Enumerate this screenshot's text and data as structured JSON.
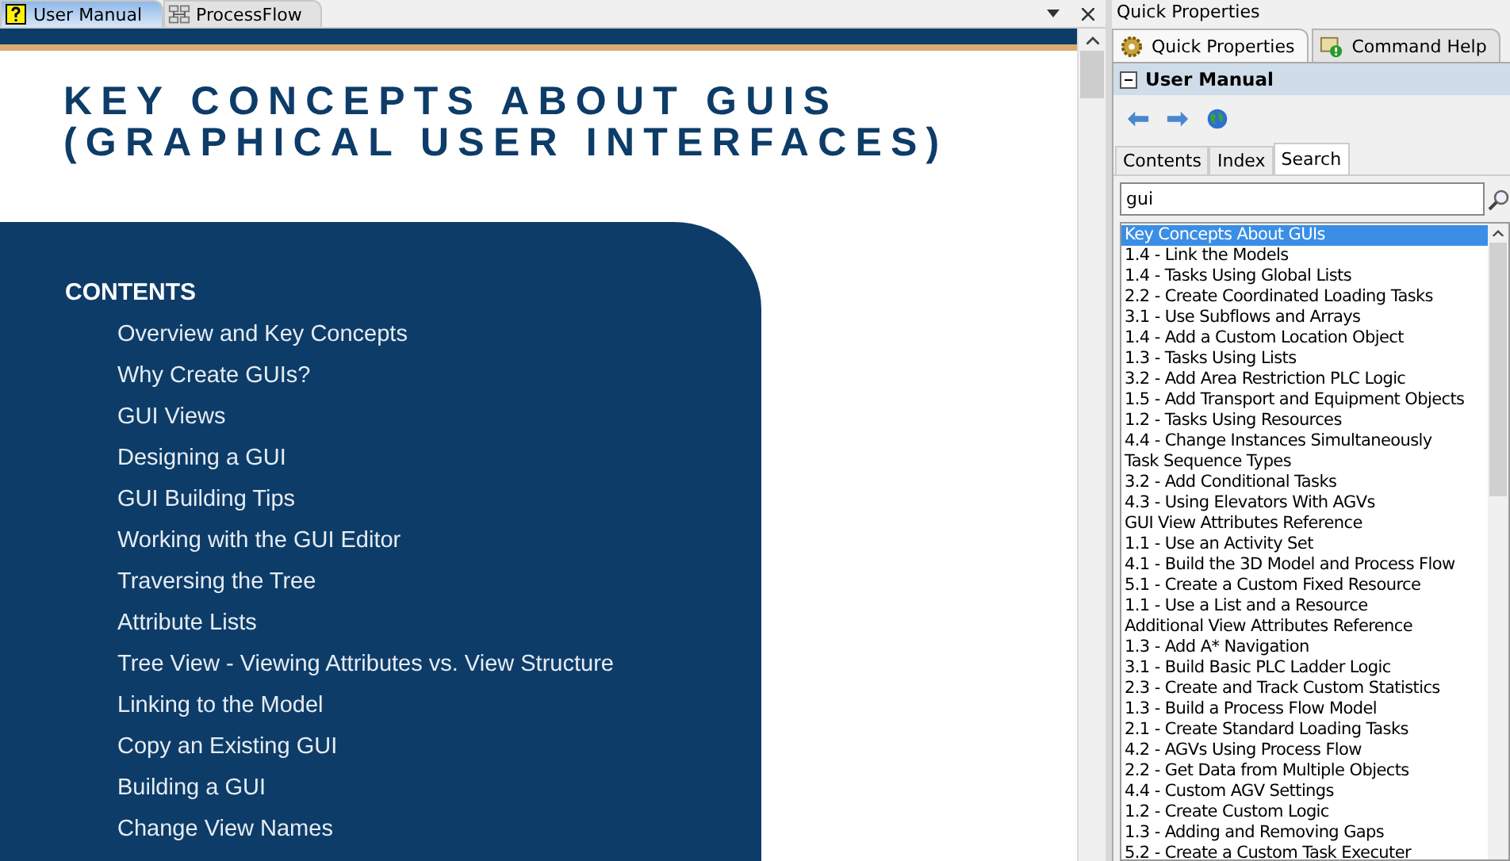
{
  "doc_tabs": [
    {
      "label": "User Manual",
      "selected": true
    },
    {
      "label": "ProcessFlow",
      "selected": false
    }
  ],
  "document": {
    "title_lines": [
      "KEY CONCEPTS ABOUT GUIS",
      "(GRAPHICAL USER INTERFACES)"
    ],
    "contents_heading": "CONTENTS",
    "contents": [
      "Overview and Key Concepts",
      "Why Create GUIs?",
      "GUI Views",
      "Designing a GUI",
      "GUI Building Tips",
      "Working with the GUI Editor",
      "Traversing the Tree",
      "Attribute Lists",
      "Tree View - Viewing Attributes vs. View Structure",
      "Linking to the Model",
      "Copy an Existing GUI",
      "Building a GUI",
      "Change View Names"
    ]
  },
  "panel": {
    "title": "Quick Properties",
    "tabs": [
      {
        "label": "Quick Properties",
        "selected": true
      },
      {
        "label": "Command Help",
        "selected": false
      }
    ],
    "section": {
      "title": "User Manual",
      "expanded": true
    },
    "help_tabs": [
      {
        "label": "Contents",
        "selected": false
      },
      {
        "label": "Index",
        "selected": false
      },
      {
        "label": "Search",
        "selected": true
      }
    ],
    "search": {
      "value": "gui"
    },
    "results": [
      {
        "label": "Key Concepts About GUIs",
        "selected": true
      },
      {
        "label": "1.4 - Link the Models",
        "selected": false
      },
      {
        "label": "1.4 - Tasks Using Global Lists",
        "selected": false
      },
      {
        "label": "2.2 - Create Coordinated Loading Tasks",
        "selected": false
      },
      {
        "label": "3.1 - Use Subflows and Arrays",
        "selected": false
      },
      {
        "label": "1.4 - Add a Custom Location Object",
        "selected": false
      },
      {
        "label": "1.3 - Tasks Using Lists",
        "selected": false
      },
      {
        "label": "3.2 - Add Area Restriction PLC Logic",
        "selected": false
      },
      {
        "label": "1.5 - Add Transport and Equipment Objects",
        "selected": false
      },
      {
        "label": "1.2 - Tasks Using Resources",
        "selected": false
      },
      {
        "label": "4.4 - Change Instances Simultaneously",
        "selected": false
      },
      {
        "label": "Task Sequence Types",
        "selected": false
      },
      {
        "label": "3.2 - Add Conditional Tasks",
        "selected": false
      },
      {
        "label": "4.3 - Using Elevators With AGVs",
        "selected": false
      },
      {
        "label": "GUI View Attributes Reference",
        "selected": false
      },
      {
        "label": "1.1 - Use an Activity Set",
        "selected": false
      },
      {
        "label": "4.1 - Build the 3D Model and Process Flow",
        "selected": false
      },
      {
        "label": "5.1 - Create a Custom Fixed Resource",
        "selected": false
      },
      {
        "label": "1.1 - Use a List and a Resource",
        "selected": false
      },
      {
        "label": "Additional View Attributes Reference",
        "selected": false
      },
      {
        "label": "1.3 - Add A* Navigation",
        "selected": false
      },
      {
        "label": "3.1 - Build Basic PLC Ladder Logic",
        "selected": false
      },
      {
        "label": "2.3 - Create and Track Custom Statistics",
        "selected": false
      },
      {
        "label": "1.3 - Build a Process Flow Model",
        "selected": false
      },
      {
        "label": "2.1 - Create Standard Loading Tasks",
        "selected": false
      },
      {
        "label": "4.2 - AGVs Using Process Flow",
        "selected": false
      },
      {
        "label": "2.2 - Get Data from Multiple Objects",
        "selected": false
      },
      {
        "label": "4.4 - Custom AGV Settings",
        "selected": false
      },
      {
        "label": "1.2 - Create Custom Logic",
        "selected": false
      },
      {
        "label": "1.3 - Adding and Removing Gaps",
        "selected": false
      },
      {
        "label": "5.2 - Create a Custom Task Executer",
        "selected": false
      }
    ]
  }
}
